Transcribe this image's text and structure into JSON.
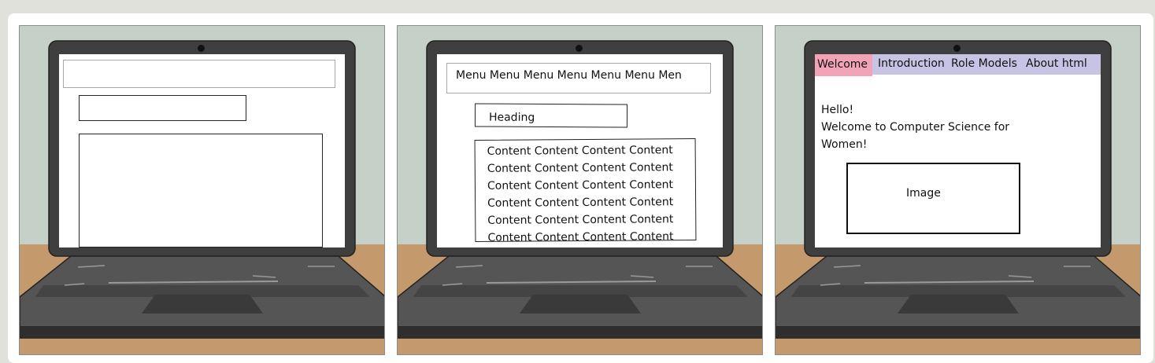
{
  "panels": [
    {
      "id": "blank-wireframe"
    },
    {
      "id": "labelled-wireframe",
      "menu_text": "Menu Menu Menu Menu Menu Menu Men",
      "heading_text": "Heading",
      "content_lines": [
        "Content Content Content Content",
        "Content Content Content Content",
        "Content Content Content Content",
        "Content Content Content Content",
        "Content Content Content Content",
        "Content Content Content Content"
      ]
    },
    {
      "id": "website-mockup",
      "nav": [
        "Welcome",
        "Introduction",
        "Role Models",
        "About html"
      ],
      "greeting_lines": [
        "Hello!",
        "Welcome to Computer Science for",
        "Women!"
      ],
      "image_label": "Image"
    }
  ],
  "colors": {
    "wall": "#c5d0c8",
    "desk": "#c49a6c",
    "laptop_frame": "#3f3f3f",
    "laptop_base": "#555555",
    "nav_bar": "#c7c3e4",
    "nav_active": "#f3a3b8"
  },
  "icons": [
    "webcam-icon",
    "touchpad-icon"
  ]
}
